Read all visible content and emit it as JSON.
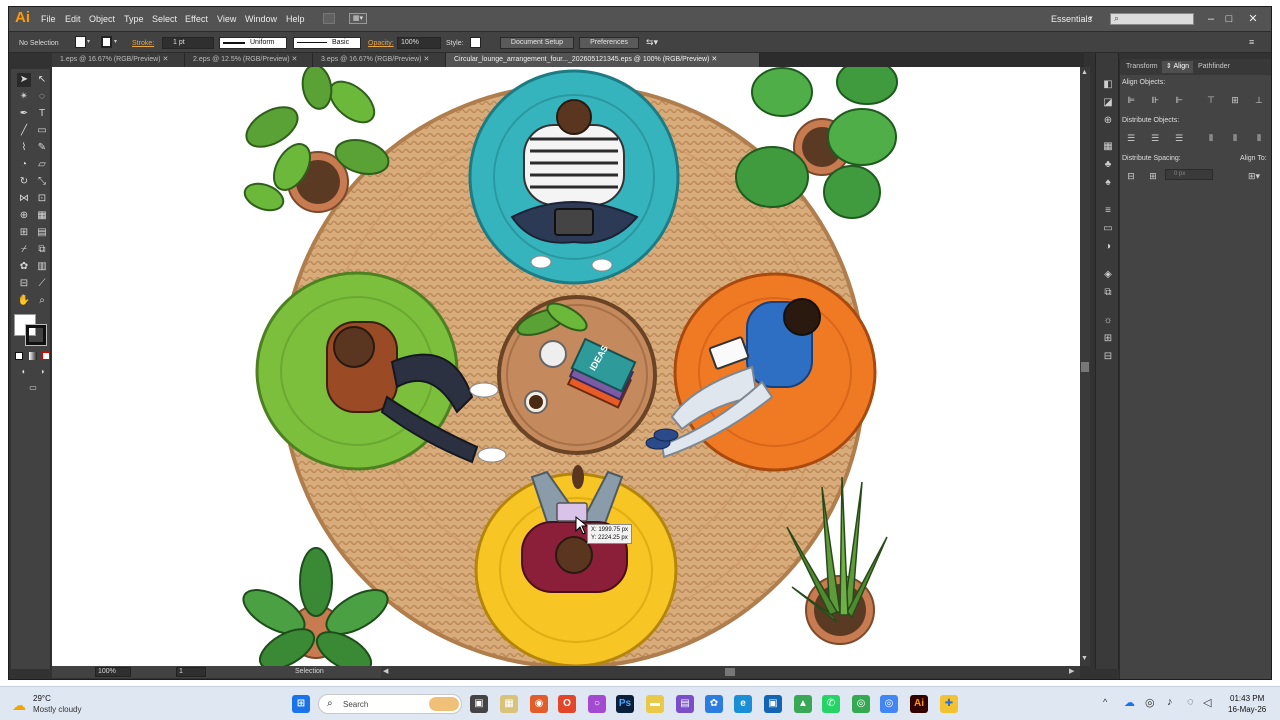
{
  "app": {
    "logo": "Ai",
    "menus": [
      "File",
      "Edit",
      "Object",
      "Type",
      "Select",
      "Effect",
      "View",
      "Window",
      "Help"
    ],
    "workspace": "Essentials",
    "window_controls": [
      "–",
      "□",
      "✕"
    ]
  },
  "control_bar": {
    "selection": "No Selection",
    "stroke_label": "Stroke:",
    "stroke_value": "1 pt",
    "profile_uniform": "Uniform",
    "brush_basic": "Basic",
    "opacity_label": "Opacity:",
    "opacity_value": "100%",
    "style_label": "Style:",
    "document_setup": "Document Setup",
    "preferences": "Preferences"
  },
  "tabs": [
    {
      "label": "1.eps @ 16.67% (RGB/Preview)",
      "close": "✕"
    },
    {
      "label": "2.eps @ 12.5% (RGB/Preview)",
      "close": "✕"
    },
    {
      "label": "3.eps @ 16.67% (RGB/Preview)",
      "close": "✕"
    },
    {
      "label": "Circular_lounge_arrangement_four..._202605121345.eps @ 100% (RGB/Preview)",
      "close": "✕"
    }
  ],
  "cursor_readout": {
    "x": "X: 1999.75 px",
    "y": "Y: 2224.25 px"
  },
  "status": {
    "zoom": "100%",
    "page": "1",
    "tool": "Selection"
  },
  "align_panel": {
    "tabs": [
      "Transform",
      "Align",
      "Pathfinder"
    ],
    "align_objects": "Align Objects:",
    "distribute_objects": "Distribute Objects:",
    "distribute_spacing": "Distribute Spacing:",
    "align_to": "Align To:",
    "spacing_value": "0 px"
  },
  "taskbar": {
    "temperature": "29°C",
    "weather": "Mostly cloudy",
    "search_placeholder": "Search",
    "time": "01:43 PM",
    "date": "16-May-26"
  },
  "colors": {
    "rug": "#d6a978",
    "table": "#c4895c",
    "teal_beanbag": "#36b4bd",
    "green_beanbag": "#7cbf3c",
    "orange_beanbag": "#f07a23",
    "yellow_beanbag": "#f7c524"
  }
}
